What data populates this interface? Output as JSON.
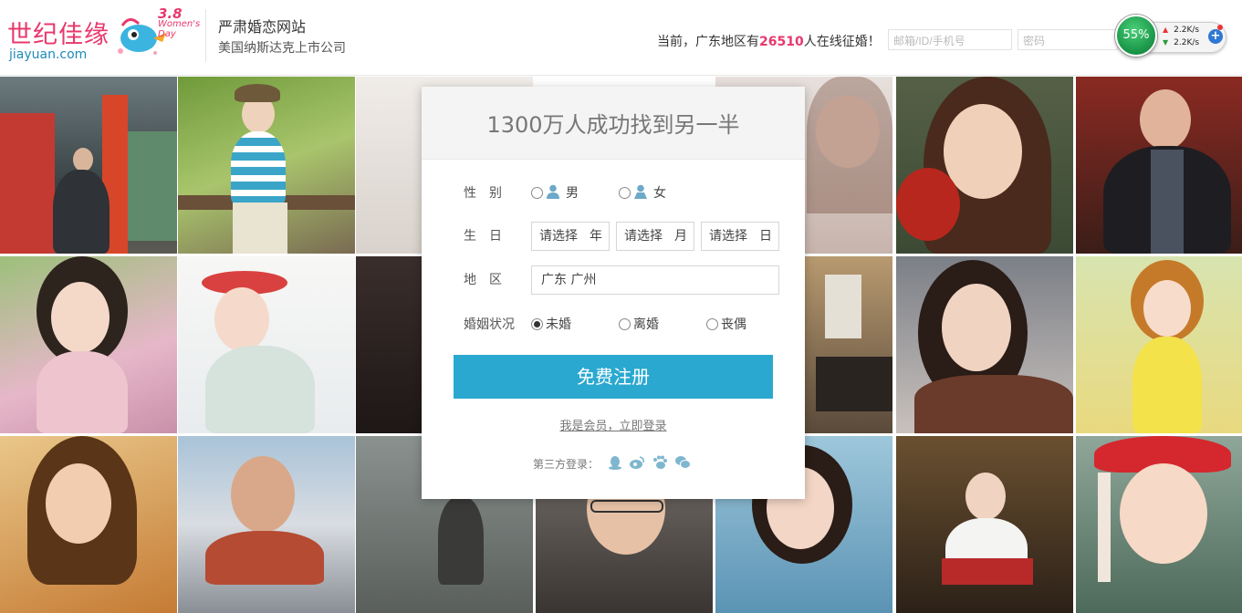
{
  "header": {
    "logo_cn": "世纪佳缘",
    "logo_en": "jiayuan.com",
    "logo_badge_top": "3.8",
    "logo_badge_line1": "Women's",
    "logo_badge_line2": "Day",
    "site_title": "严肃婚恋网站",
    "site_subtitle": "美国纳斯达克上市公司",
    "online_prefix": "当前，广东地区有",
    "online_count": "26510",
    "online_suffix": "人在线征婚！",
    "account_placeholder": "邮箱/ID/手机号",
    "password_placeholder": "密码"
  },
  "speed_widget": {
    "percent": "55%",
    "upload": "2.2K/s",
    "download": "2.2K/s",
    "plus": "+"
  },
  "panel": {
    "headline": "1300万人成功找到另一半",
    "gender_label": "性　别",
    "gender_male": "男",
    "gender_female": "女",
    "birthday_label": "生　日",
    "birthday_year_placeholder": "请选择",
    "birthday_year_unit": "年",
    "birthday_month_placeholder": "请选择",
    "birthday_month_unit": "月",
    "birthday_day_placeholder": "请选择",
    "birthday_day_unit": "日",
    "region_label": "地　区",
    "region_value": "广东 广州",
    "marital_label": "婚姻状况",
    "marital_options": [
      "未婚",
      "离婚",
      "丧偶"
    ],
    "marital_selected": "未婚",
    "submit_label": "免费注册",
    "login_link": "我是会员，立即登录",
    "third_party_label": "第三方登录："
  },
  "colors": {
    "brand_pink": "#e8386d",
    "button_blue": "#2aa8d0",
    "online_count": "#e8386d"
  },
  "icons": [
    "qq-icon",
    "weibo-icon",
    "baidu-icon",
    "wechat-icon"
  ]
}
